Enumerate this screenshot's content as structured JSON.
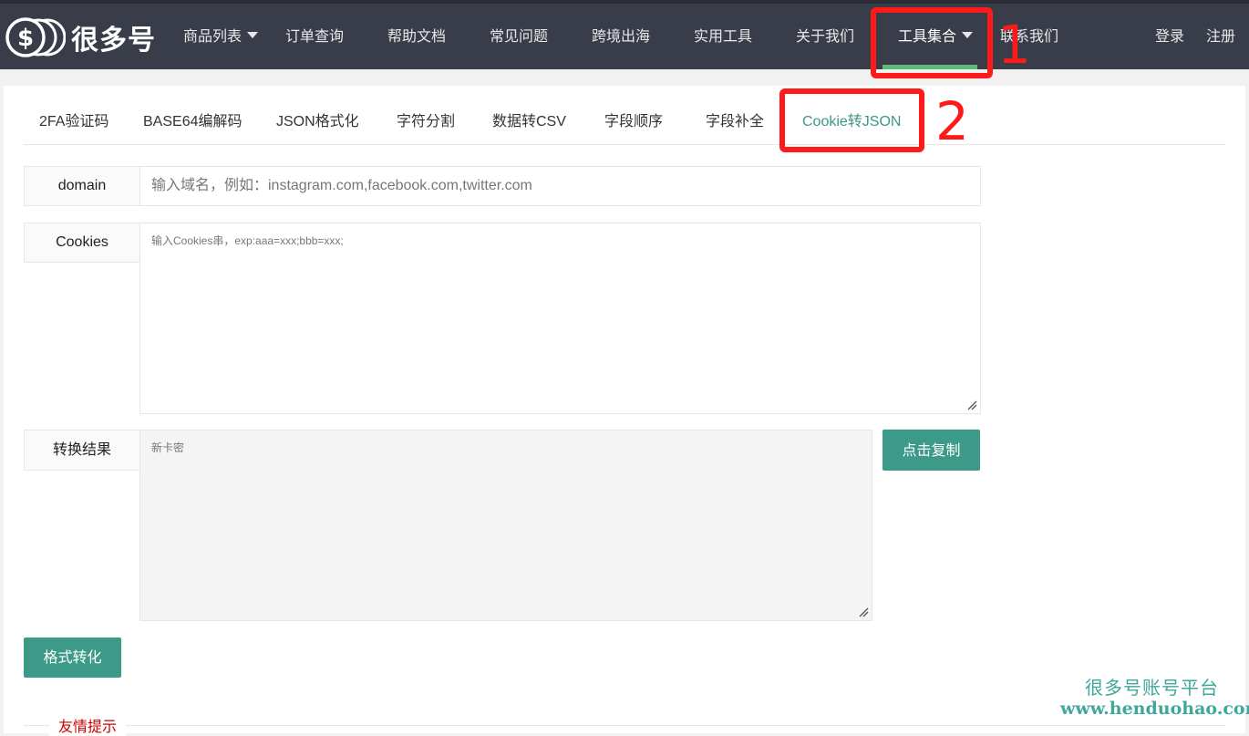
{
  "brand": {
    "logo_icon": "dollar-coins-icon",
    "name": "很多号"
  },
  "nav": {
    "items": [
      {
        "label": "商品列表",
        "dropdown": true
      },
      {
        "label": "订单查询"
      },
      {
        "label": "帮助文档"
      },
      {
        "label": "常见问题"
      },
      {
        "label": "跨境出海"
      },
      {
        "label": "实用工具"
      },
      {
        "label": "关于我们"
      },
      {
        "label": "工具集合",
        "dropdown": true,
        "active": true
      },
      {
        "label": "联系我们"
      }
    ],
    "login": "登录",
    "register": "注册"
  },
  "annotations": {
    "step1": "1",
    "step2": "2",
    "color": "#ff1a1a"
  },
  "tabs": [
    {
      "label": "2FA验证码"
    },
    {
      "label": "BASE64编解码"
    },
    {
      "label": "JSON格式化"
    },
    {
      "label": "字符分割"
    },
    {
      "label": "数据转CSV"
    },
    {
      "label": "字段顺序"
    },
    {
      "label": "字段补全"
    },
    {
      "label": "Cookie转JSON",
      "active": true
    }
  ],
  "form": {
    "domain": {
      "label": "domain",
      "placeholder": "输入域名，例如：instagram.com,facebook.com,twitter.com"
    },
    "cookies": {
      "label": "Cookies",
      "placeholder": "输入Cookies串，exp:aaa=xxx;bbb=xxx;"
    },
    "result": {
      "label": "转换结果",
      "placeholder": "新卡密"
    },
    "copy_button": "点击复制",
    "convert_button": "格式转化"
  },
  "tip": {
    "title": "友情提示"
  },
  "watermark": {
    "line1": "很多号账号平台",
    "line2": "www.henduohao.com"
  },
  "colors": {
    "nav_bg": "#393d49",
    "accent": "#3d9988",
    "active_tab": "#3f9685",
    "nav_underline": "#5fb878"
  }
}
